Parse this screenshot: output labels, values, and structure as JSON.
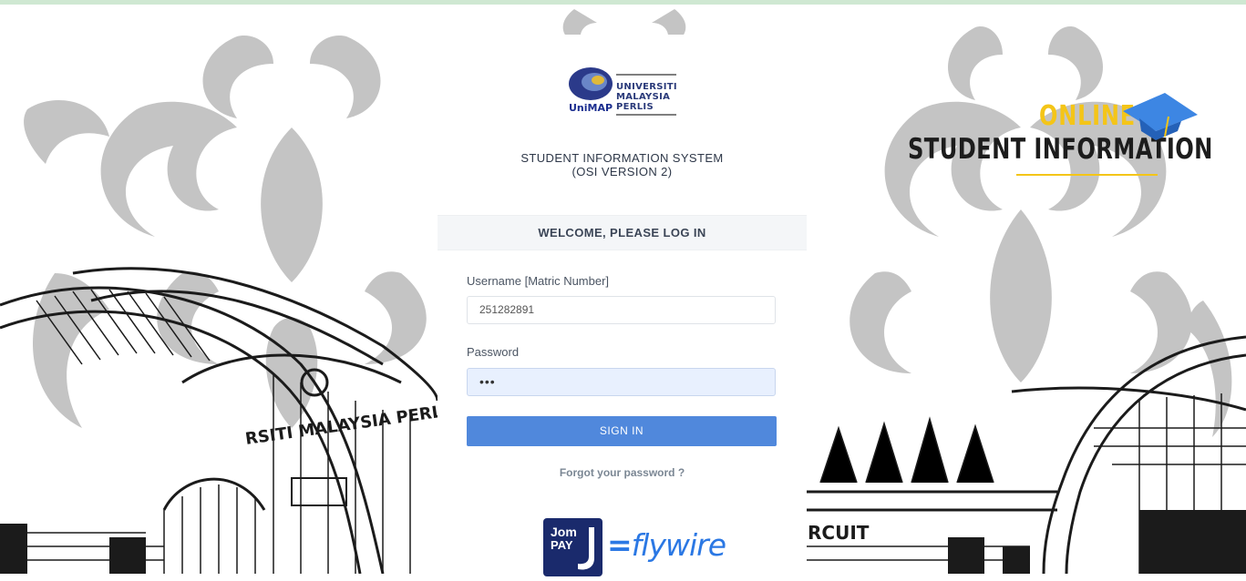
{
  "branding": {
    "logo_lines": [
      "UNIVERSITI",
      "MALAYSIA",
      "PERLIS"
    ],
    "logo_mark": "UniMAP",
    "osi_online": "ONLINE",
    "osi_student_information": "STUDENT INFORMATION",
    "accent_yellow": "#f4c518",
    "accent_blue": "#2b78e4"
  },
  "card": {
    "system_title": "STUDENT INFORMATION SYSTEM",
    "system_version": "(OSI VERSION 2)",
    "welcome": "WELCOME, PLEASE LOG IN"
  },
  "form": {
    "username_label": "Username [Matric Number]",
    "username_value": "251282891",
    "password_label": "Password",
    "password_value": "•••",
    "signin_label": "SIGN IN",
    "forgot_label": "Forgot your password ?"
  },
  "payments": {
    "jompay_top": "Jom",
    "jompay_bottom": "PAY",
    "flywire": "flywire"
  },
  "icons": {
    "graduation_cap": "graduation-cap-icon",
    "logo": "unimap-logo"
  }
}
